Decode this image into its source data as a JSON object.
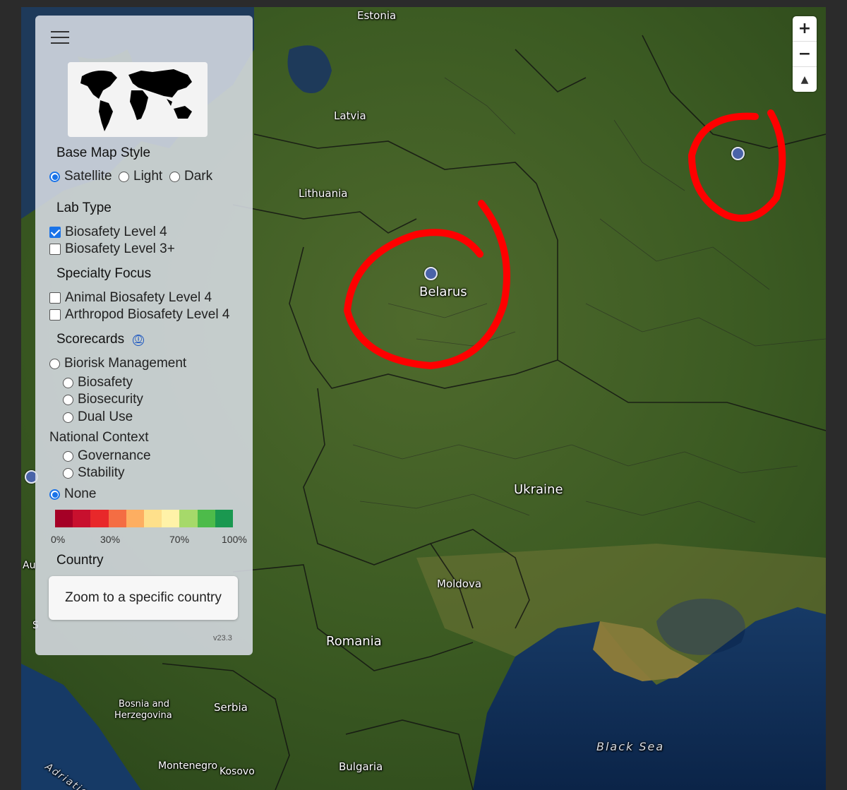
{
  "map": {
    "labels": {
      "estonia": "Estonia",
      "latvia": "Latvia",
      "lithuania": "Lithuania",
      "belarus": "Belarus",
      "ukraine": "Ukraine",
      "moldova": "Moldova",
      "romania": "Romania",
      "serbia": "Serbia",
      "bosnia1": "Bosnia and",
      "bosnia2": "Herzegovina",
      "montenegro": "Montenegro",
      "kosovo": "Kosovo",
      "bulgaria": "Bulgaria",
      "black_sea": "Black Sea",
      "adriatic": "Adriatic Sea",
      "austria_partial": "Au",
      "partial_s": "S"
    },
    "annotation_color": "#ff0000",
    "marker_color": "#4a63a8"
  },
  "zoom": {
    "in": "+",
    "out": "−",
    "compass": "▲"
  },
  "panel": {
    "base_map_style": {
      "title": "Base Map Style",
      "options": [
        "Satellite",
        "Light",
        "Dark"
      ],
      "selected": "Satellite"
    },
    "lab_type": {
      "title": "Lab Type",
      "options": [
        "Biosafety Level 4",
        "Biosafety Level 3+"
      ],
      "checked": [
        "Biosafety Level 4"
      ]
    },
    "specialty_focus": {
      "title": "Specialty Focus",
      "options": [
        "Animal Biosafety Level 4",
        "Arthropod Biosafety Level 4"
      ]
    },
    "scorecards": {
      "title": "Scorecards",
      "info_icon": "ⓘ",
      "biorisk": "Biorisk Management",
      "biosafety": "Biosafety",
      "biosecurity": "Biosecurity",
      "dual_use": "Dual Use",
      "national_context": "National Context",
      "governance": "Governance",
      "stability": "Stability",
      "none": "None",
      "selected": "None"
    },
    "scale": {
      "colors": [
        "#a50026",
        "#c8102e",
        "#e8282a",
        "#f46d43",
        "#fdae61",
        "#fee08b",
        "#fff2a8",
        "#a6d96a",
        "#4dbb4a",
        "#1a9850"
      ],
      "ticks": [
        "0%",
        "30%",
        "70%",
        "100%"
      ]
    },
    "country": {
      "title": "Country",
      "button": "Zoom to a specific country"
    },
    "version": "v23.3"
  }
}
